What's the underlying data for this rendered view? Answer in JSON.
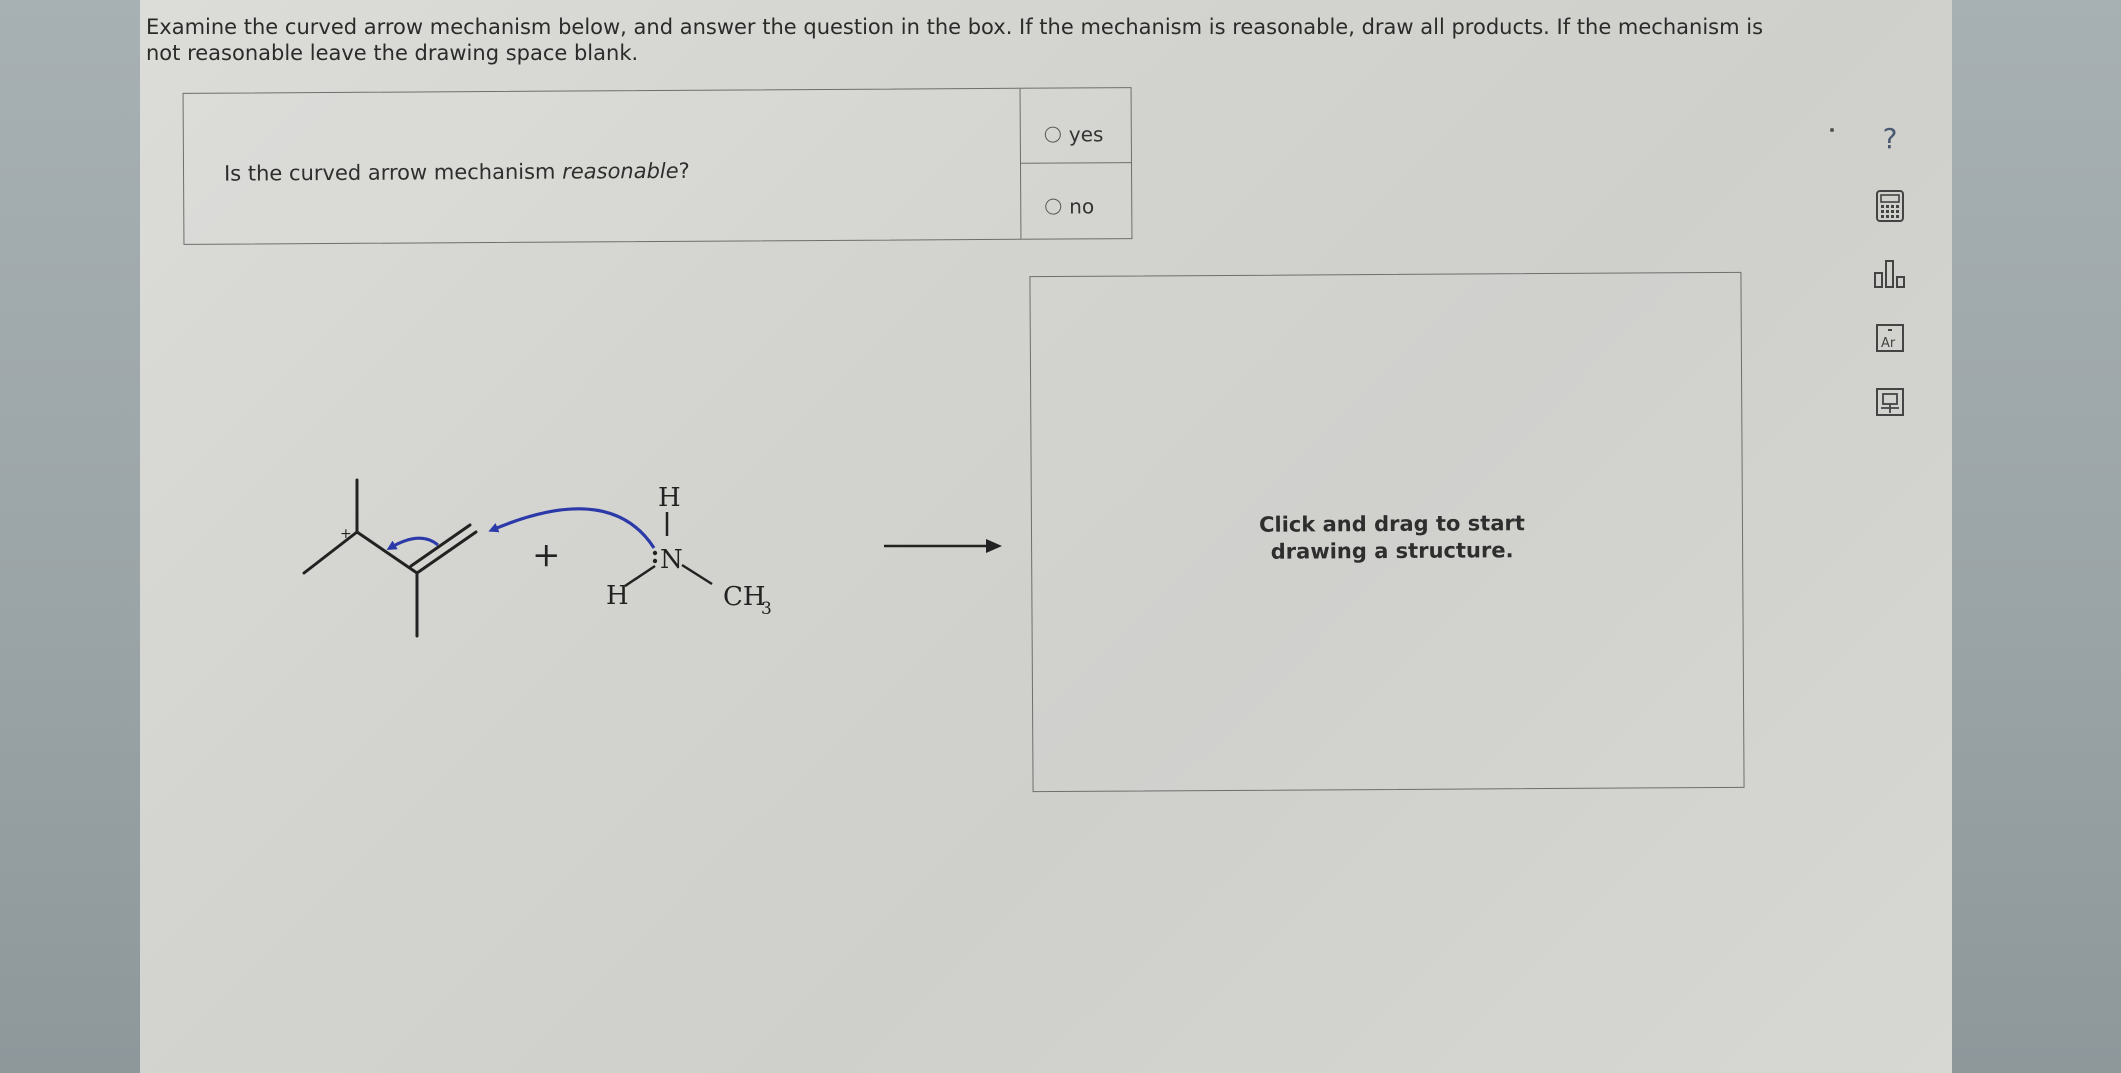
{
  "instructions": "Examine the curved arrow mechanism below, and answer the question in the box. If the mechanism is reasonable, draw all products. If the mechanism is not reasonable leave the drawing space blank.",
  "question": {
    "text_before": "Is the curved arrow mechanism ",
    "text_emphasis": "reasonable",
    "text_after": "?"
  },
  "options": [
    {
      "label": "yes",
      "selected": false
    },
    {
      "label": "no",
      "selected": false
    }
  ],
  "molecule": {
    "amine_atoms": {
      "n": "N",
      "h_top": "H",
      "h_left": "H",
      "methyl": "CH",
      "methyl_subscript": "3"
    },
    "charge": "+",
    "plus_sign": "+"
  },
  "drawing_area": {
    "prompt_line1": "Click and drag to start",
    "prompt_line2": "drawing a structure."
  },
  "toolbar": [
    {
      "icon": "help-icon",
      "glyph": "?"
    },
    {
      "icon": "calculator-icon"
    },
    {
      "icon": "bar-chart-icon"
    },
    {
      "icon": "periodic-table-icon",
      "text": "Ar"
    },
    {
      "icon": "reference-icon"
    }
  ],
  "colors": {
    "arrow": "#2b3aa8",
    "text": "#2b2b2b",
    "help": "#4a5a70"
  }
}
